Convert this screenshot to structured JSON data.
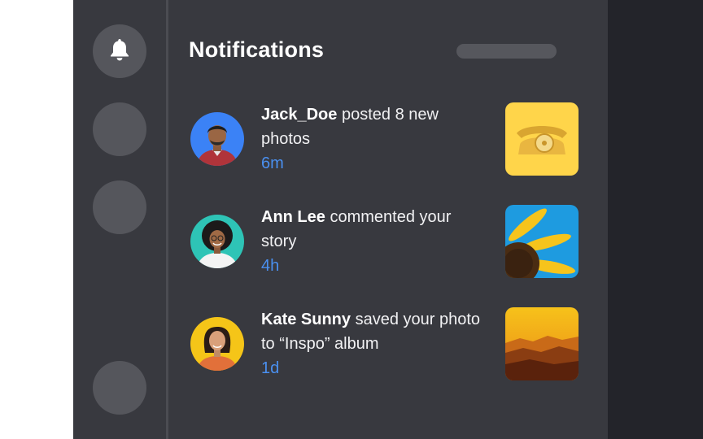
{
  "header": {
    "title": "Notifications"
  },
  "sidebar": {
    "items": [
      {
        "icon": "bell-icon",
        "label": ""
      },
      {
        "icon": "",
        "label": ""
      },
      {
        "icon": "",
        "label": ""
      },
      {
        "icon": "",
        "label": ""
      }
    ]
  },
  "notifications": [
    {
      "user": "Jack_Doe",
      "action": " posted 8 new photos",
      "time": "6m",
      "avatar_bg": "#3b82f6",
      "thumbnail": "rotary-phone-photo",
      "thumbnail_bg": "#ffd54a"
    },
    {
      "user": "Ann Lee",
      "action": " commented your story",
      "time": "4h",
      "avatar_bg": "#2ec4b6",
      "thumbnail": "sunflower-photo",
      "thumbnail_bg": "#1e9be0"
    },
    {
      "user": "Kate Sunny",
      "action": " saved your photo to “Inspo” album",
      "time": "1d",
      "avatar_bg": "#f5c518",
      "thumbnail": "sunset-mountains-photo",
      "thumbnail_bg": "#e0a020"
    }
  ],
  "colors": {
    "panel": "#38393f",
    "accent_time": "#4a90f0",
    "outer_dark": "#23242a"
  }
}
